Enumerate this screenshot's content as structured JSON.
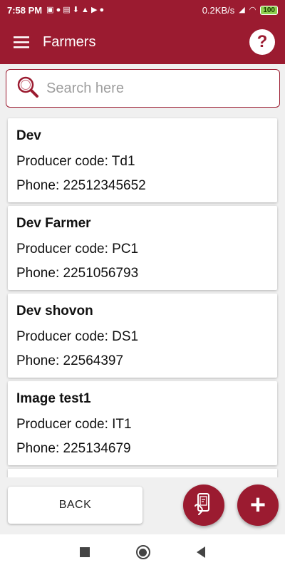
{
  "status_bar": {
    "time": "7:58 PM",
    "speed": "0.2KB/s",
    "battery": "100"
  },
  "app_bar": {
    "title": "Farmers",
    "help_label": "?"
  },
  "search": {
    "placeholder": "Search here",
    "value": ""
  },
  "farmers": [
    {
      "name": "Dev",
      "producer_code": "Producer code: Td1",
      "phone": "Phone: 22512345652"
    },
    {
      "name": "Dev Farmer",
      "producer_code": "Producer code: PC1",
      "phone": "Phone: 2251056793"
    },
    {
      "name": "Dev shovon",
      "producer_code": "Producer code: DS1",
      "phone": "Phone: 22564397"
    },
    {
      "name": "Image test1",
      "producer_code": "Producer code: IT1",
      "phone": "Phone: 225134679"
    }
  ],
  "bottom": {
    "back_label": "BACK",
    "add_label": "+"
  },
  "colors": {
    "primary": "#9b1b30",
    "background": "#f0f0f0"
  },
  "icons": [
    "menu-icon",
    "help-icon",
    "search-icon",
    "phone-scan-icon",
    "add-icon"
  ]
}
